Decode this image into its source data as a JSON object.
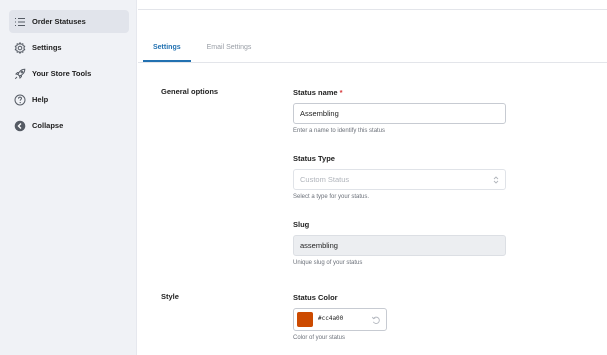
{
  "sidebar": {
    "items": [
      {
        "label": "Order Statuses",
        "icon": "list-icon",
        "active": true
      },
      {
        "label": "Settings",
        "icon": "gear-icon",
        "active": false
      },
      {
        "label": "Your Store Tools",
        "icon": "rocket-icon",
        "active": false
      },
      {
        "label": "Help",
        "icon": "help-icon",
        "active": false
      },
      {
        "label": "Collapse",
        "icon": "collapse-icon",
        "active": false
      }
    ]
  },
  "tabs": [
    {
      "label": "Settings",
      "active": true
    },
    {
      "label": "Email Settings",
      "active": false
    }
  ],
  "sections": {
    "general": "General options",
    "style": "Style"
  },
  "fields": {
    "status_name": {
      "label": "Status name",
      "required_mark": "*",
      "value": "Assembling",
      "help": "Enter a name to identify this status"
    },
    "status_type": {
      "label": "Status Type",
      "placeholder": "Custom Status",
      "help": "Select a type for your status."
    },
    "slug": {
      "label": "Slug",
      "value": "assembling",
      "help": "Unique slug of your status"
    },
    "status_color": {
      "label": "Status Color",
      "value": "#cc4a00",
      "help": "Color of your status"
    }
  },
  "colors": {
    "accent": "#2271b1",
    "status_swatch": "#cc4a00",
    "required": "#d63638"
  }
}
